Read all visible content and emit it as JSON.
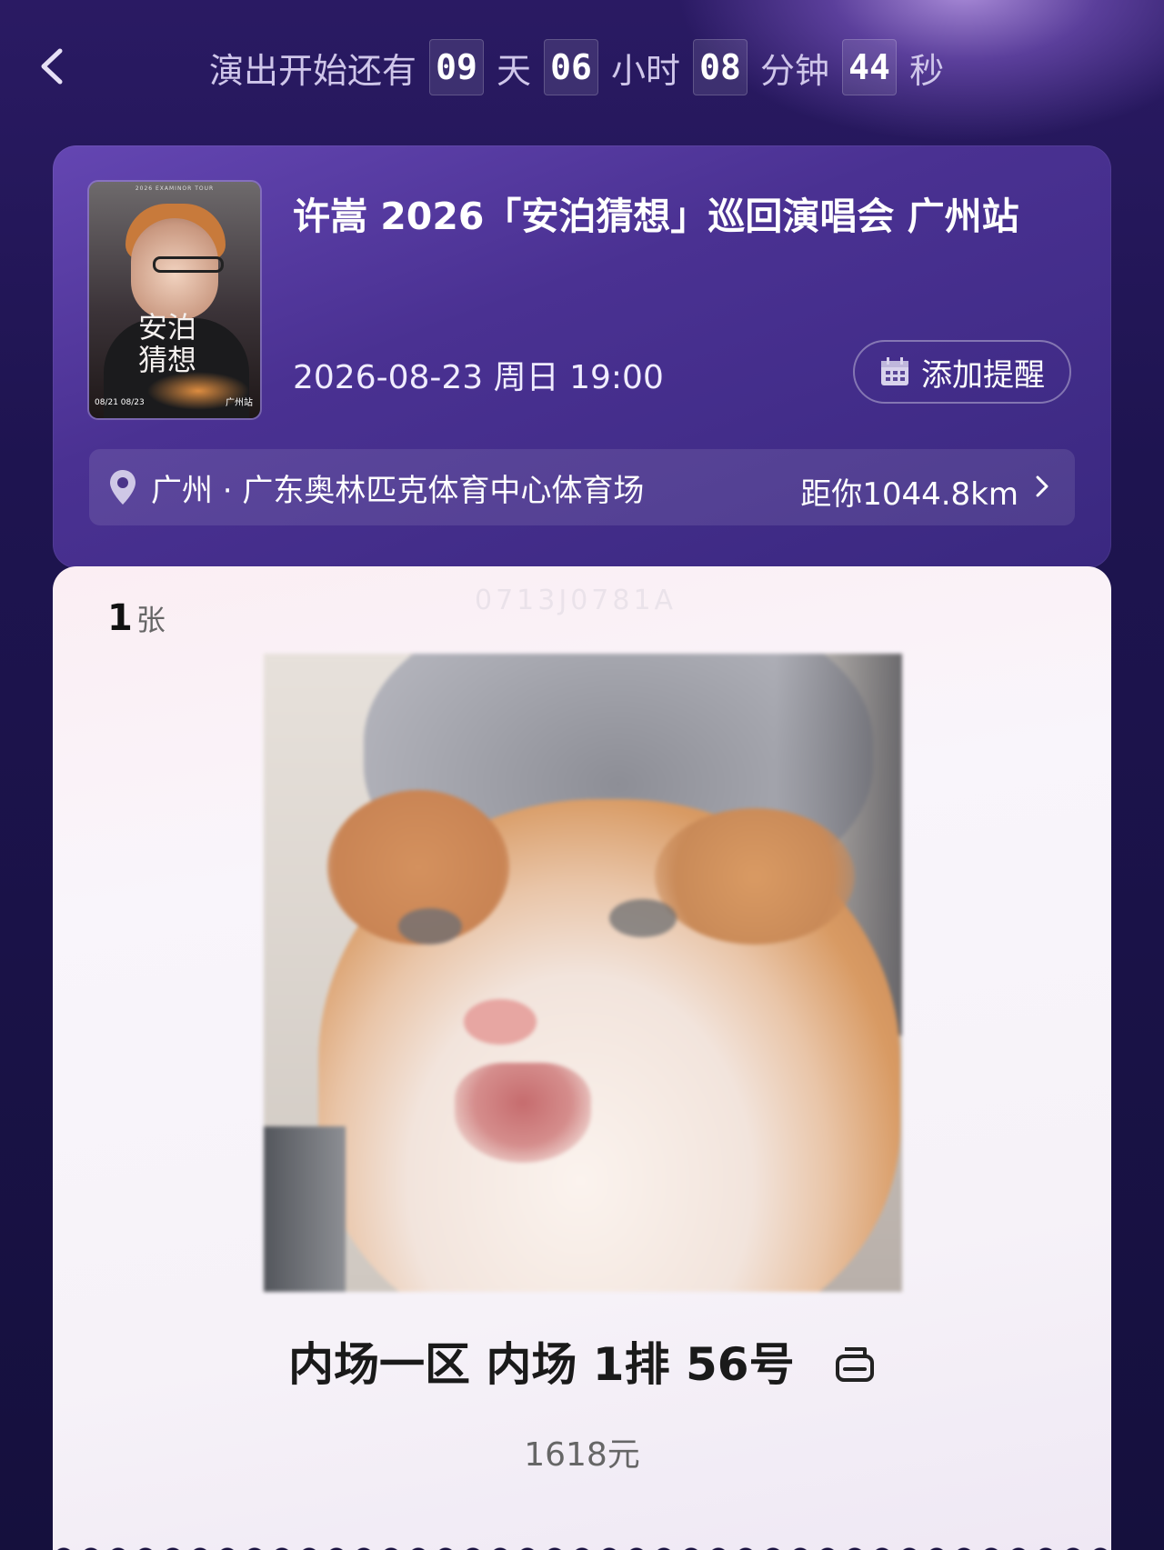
{
  "countdown": {
    "prefix": "演出开始还有",
    "days": "09",
    "days_unit": "天",
    "hours": "06",
    "hours_unit": "小时",
    "minutes": "08",
    "minutes_unit": "分钟",
    "seconds": "44",
    "seconds_unit": "秒"
  },
  "event": {
    "title": "许嵩 2026「安泊猜想」巡回演唱会 广州站",
    "datetime": "2026-08-23 周日 19:00",
    "reminder_label": "添加提醒",
    "venue": "广州 · 广东奥林匹克体育中心体育场",
    "distance": "距你1044.8km",
    "poster": {
      "title_line1": "安泊",
      "title_line2": "猜想",
      "dates": "08/21  08/23",
      "city": "广州站",
      "tour": "2026 EXAMINOR TOUR"
    }
  },
  "ticket": {
    "count": "1",
    "count_unit": "张",
    "watermark": "0713J0781A",
    "seat": "内场一区 内场 1排 56号",
    "price": "1618元"
  },
  "icons": {
    "back": "chevron-left-icon",
    "calendar": "calendar-icon",
    "location": "location-pin-icon",
    "chevron": "chevron-right-icon",
    "copy": "copy-icon"
  }
}
